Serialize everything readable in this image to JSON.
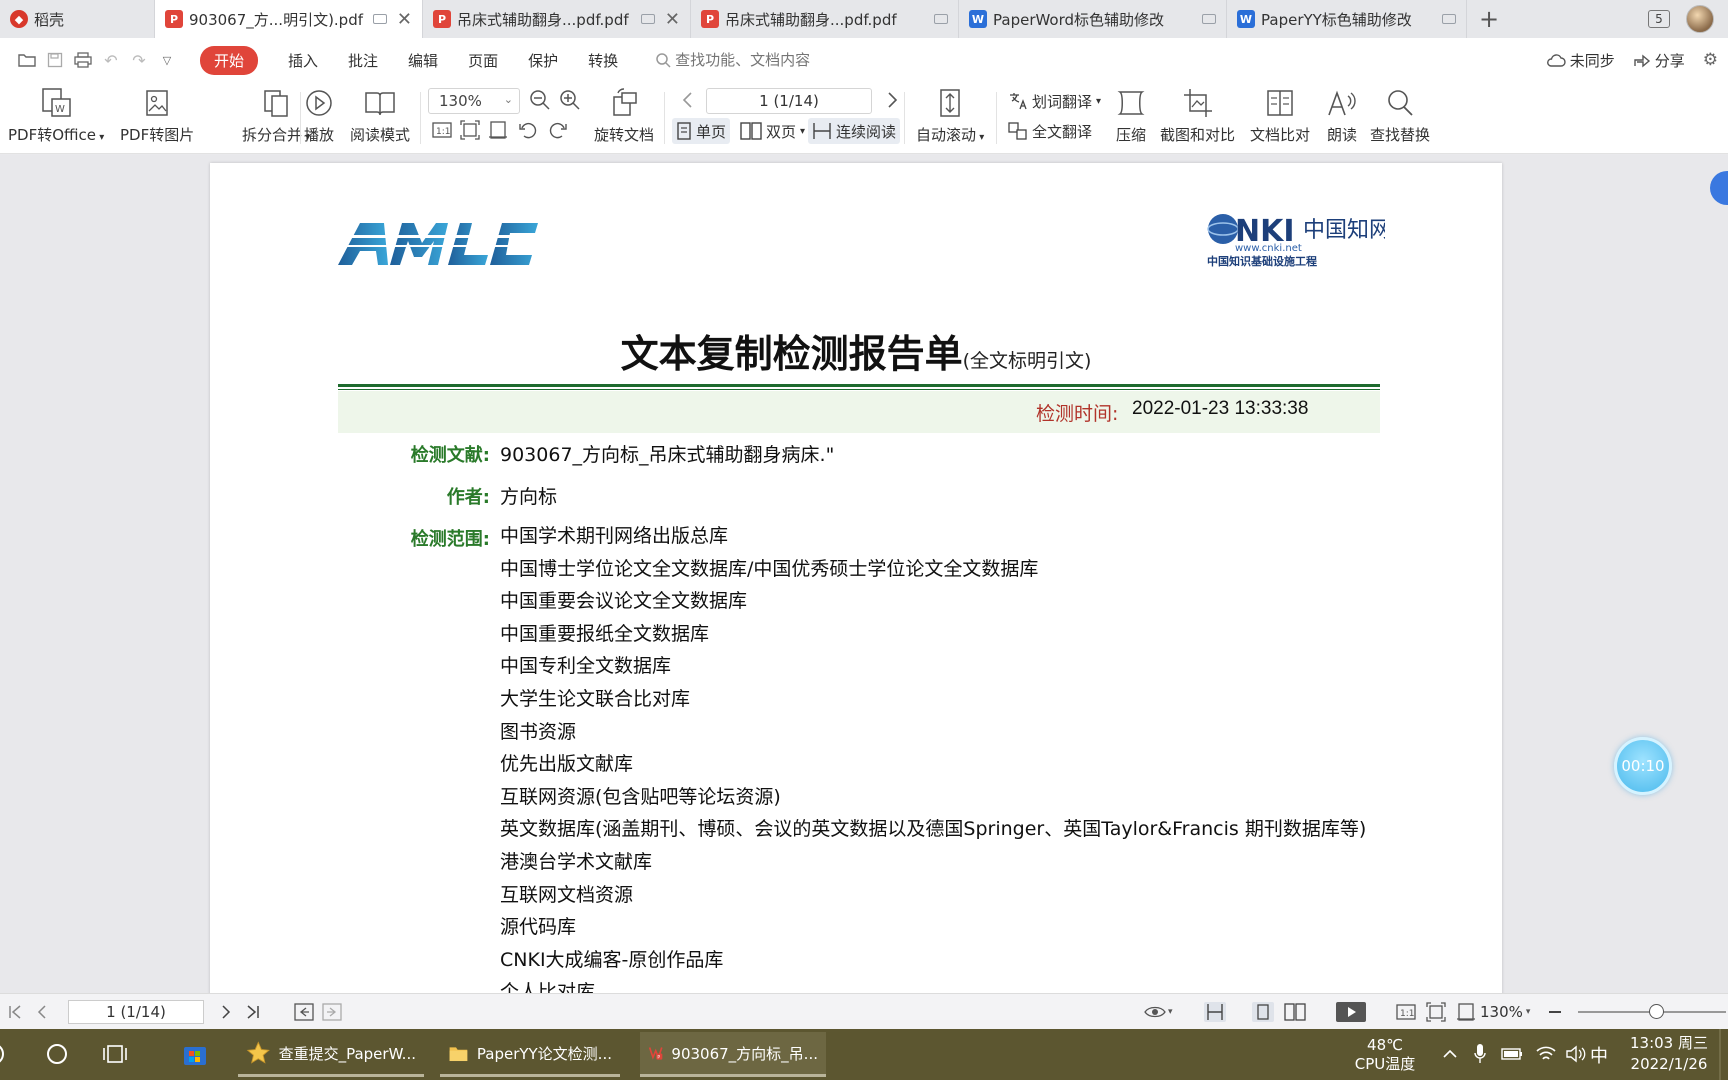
{
  "tabs": [
    {
      "label": "稻壳",
      "icon": "shell"
    },
    {
      "label": "903067_方...明引文).pdf",
      "icon": "pdf",
      "active": true
    },
    {
      "label": "吊床式辅助翻身...pdf.pdf",
      "icon": "pdf"
    },
    {
      "label": "吊床式辅助翻身...pdf.pdf",
      "icon": "pdf"
    },
    {
      "label": "PaperWord标色辅助修改",
      "icon": "doc"
    },
    {
      "label": "PaperYY标色辅助修改",
      "icon": "doc"
    }
  ],
  "tabbar": {
    "add_label": "+",
    "window_count": "5"
  },
  "menu": {
    "items": [
      "开始",
      "插入",
      "批注",
      "编辑",
      "页面",
      "保护",
      "转换"
    ],
    "search_placeholder": "查找功能、文档内容",
    "sync_label": "未同步",
    "share_label": "分享"
  },
  "ribbon": {
    "pdf_to_office": "PDF转Office",
    "pdf_to_image": "PDF转图片",
    "split_merge": "拆分合并",
    "play": "播放",
    "read_mode": "阅读模式",
    "zoom_value": "130%",
    "page_indicator": "1 (1/14)",
    "rotate": "旋转文档",
    "single_page": "单页",
    "double_page": "双页",
    "continuous": "连续阅读",
    "auto_scroll": "自动滚动",
    "word_translate": "划词翻译",
    "full_translate": "全文翻译",
    "compress": "压缩",
    "screenshot_compare": "截图和对比",
    "doc_compare": "文档比对",
    "read_aloud": "朗读",
    "find_replace": "查找替换"
  },
  "document": {
    "logo_right_sub": "www.cnki.net",
    "logo_right_cn": "中国知识基础设施工程",
    "title": "文本复制检测报告单",
    "subtitle": "(全文标明引文)",
    "time_label": "检测时间:",
    "time_value": "2022-01-23 13:33:38",
    "doc_label": "检测文献:",
    "doc_value": "903067_方向标_吊床式辅助翻身病床.\"",
    "author_label": "作者:",
    "author_value": "方向标",
    "scope_label": "检测范围:",
    "scope_items": [
      "中国学术期刊网络出版总库",
      "中国博士学位论文全文数据库/中国优秀硕士学位论文全文数据库",
      "中国重要会议论文全文数据库",
      "中国重要报纸全文数据库",
      "中国专利全文数据库",
      "大学生论文联合比对库",
      "图书资源",
      "优先出版文献库",
      "互联网资源(包含贴吧等论坛资源)",
      "英文数据库(涵盖期刊、博硕、会议的英文数据以及德国Springer、英国Taylor&Francis 期刊数据库等)",
      "港澳台学术文献库",
      "互联网文档资源",
      "源代码库",
      "CNKI大成编客-原创作品库",
      "个人比对库"
    ]
  },
  "timer": "00:10",
  "statusbar": {
    "page_indicator": "1 (1/14)",
    "zoom_value": "130%",
    "zoom_level": 0.53
  },
  "taskbar": {
    "apps": [
      {
        "label": "查重提交_PaperW..."
      },
      {
        "label": "PaperYY论文检测..."
      },
      {
        "label": "903067_方向标_吊...",
        "active": true
      }
    ],
    "temp": "48℃",
    "temp_label": "CPU温度",
    "ime": "中",
    "time": "13:03 周三",
    "date": "2022/1/26"
  },
  "colors": {
    "accent_red": "#e0453a",
    "label_green": "#2a7a2a",
    "time_red": "#b1332a",
    "rule_green": "#1e6b2e",
    "taskbar": "#5c5630"
  }
}
